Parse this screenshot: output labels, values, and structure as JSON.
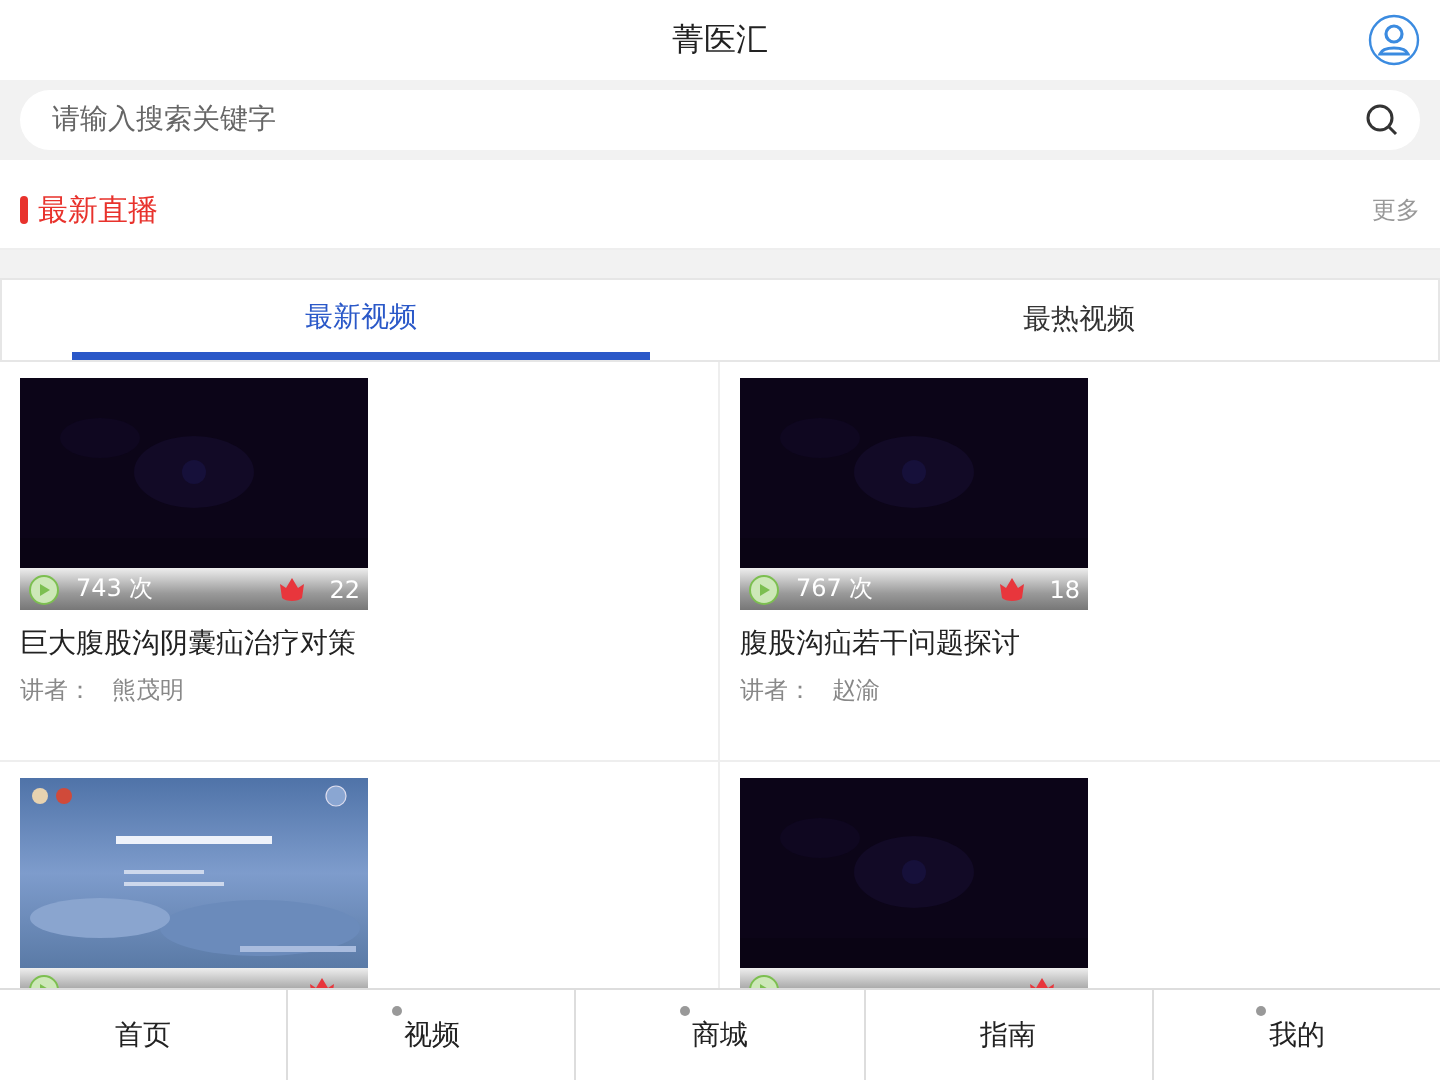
{
  "header": {
    "title": "菁医汇"
  },
  "search": {
    "placeholder": "请输入搜索关键字"
  },
  "live_section": {
    "title": "最新直播",
    "more": "更多"
  },
  "tabs": [
    {
      "label": "最新视频",
      "selected": true
    },
    {
      "label": "最热视频",
      "selected": false
    }
  ],
  "videos": [
    {
      "kind": "picture",
      "views": "743 次",
      "likes": "22",
      "title": "巨大腹股沟阴囊疝治疗对策",
      "speaker_label": "讲者：",
      "speaker": "熊茂明"
    },
    {
      "kind": "picture",
      "views": "767 次",
      "likes": "18",
      "title": "腹股沟疝若干问题探讨",
      "speaker_label": "讲者：",
      "speaker": "赵渝"
    },
    {
      "kind": "picture"
    },
    {
      "kind": "picture"
    }
  ],
  "bottom_nav": [
    {
      "label": "首页",
      "dot": false
    },
    {
      "label": "视频",
      "dot": true
    },
    {
      "label": "商城",
      "dot": true
    },
    {
      "label": "指南",
      "dot": false
    },
    {
      "label": "我的",
      "dot": true
    }
  ]
}
